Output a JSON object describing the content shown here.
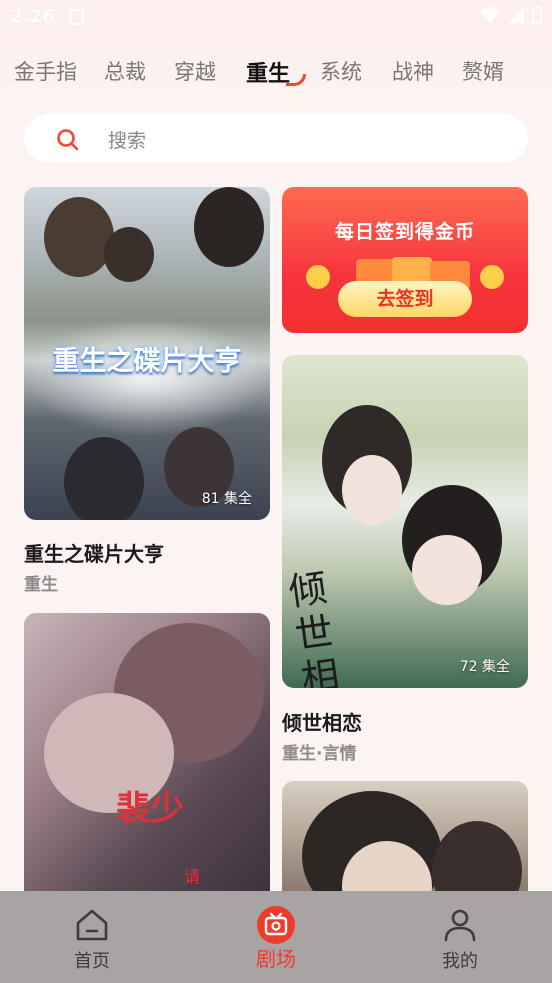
{
  "status_bar": {
    "time": "2:26"
  },
  "category_tabs": [
    {
      "label": "金手指",
      "active": false
    },
    {
      "label": "总裁",
      "active": false
    },
    {
      "label": "穿越",
      "active": false
    },
    {
      "label": "重生",
      "active": true
    },
    {
      "label": "系统",
      "active": false
    },
    {
      "label": "战神",
      "active": false
    },
    {
      "label": "赘婿",
      "active": false
    }
  ],
  "search": {
    "placeholder": "搜索"
  },
  "cards": [
    {
      "title": "重生之碟片大亨",
      "tag": "重生",
      "episodes": "81 集全",
      "poster_text": "重生之碟片大亨"
    },
    {
      "title": "倾世相恋",
      "tag": "重生·言情",
      "episodes": "72 集全",
      "poster_text": "倾世相恋"
    },
    {
      "poster_text": "裴少",
      "poster_small": "请"
    }
  ],
  "banner": {
    "title": "每日签到得金币",
    "button": "去签到"
  },
  "bottom_nav": [
    {
      "label": "首页",
      "icon": "home-icon",
      "active": false
    },
    {
      "label": "剧场",
      "icon": "theater-icon",
      "active": true
    },
    {
      "label": "我的",
      "icon": "profile-icon",
      "active": false
    }
  ],
  "colors": {
    "accent": "#f2462f",
    "background": "#fbf4f3",
    "nav_bar": "#a9a4a4"
  }
}
